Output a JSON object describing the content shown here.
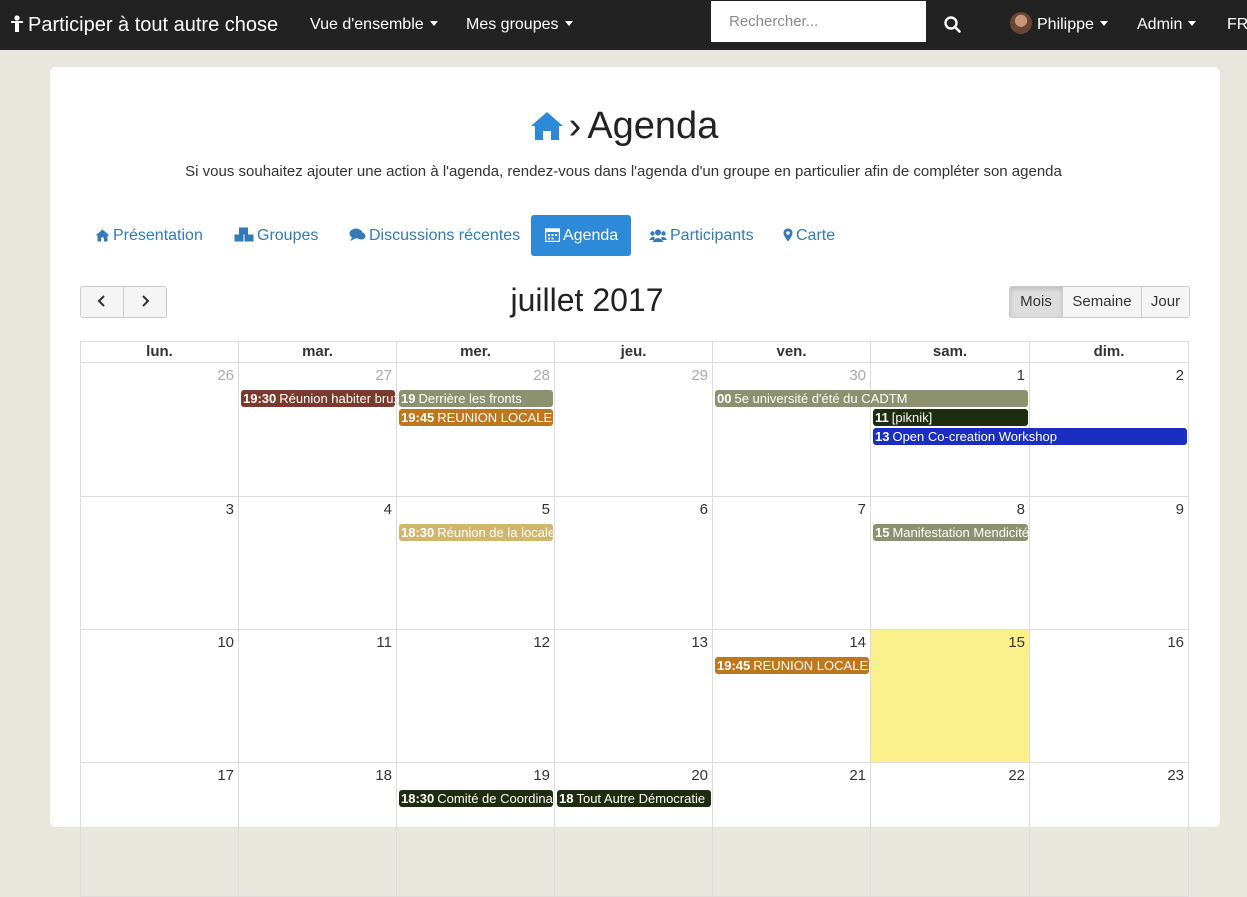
{
  "navbar": {
    "brand": "Participer à tout autre chose",
    "menu_overview": "Vue d'ensemble",
    "menu_groups": "Mes groupes",
    "search_placeholder": "Rechercher...",
    "user": "Philippe",
    "admin": "Admin",
    "lang": "FR"
  },
  "page": {
    "title": "Agenda",
    "subtitle": "Si vous souhaitez ajouter une action à l'agenda, rendez-vous dans l'agenda d'un groupe en particulier afin de compléter son agenda"
  },
  "tabs": [
    {
      "label": "Présentation",
      "icon": "home-icon",
      "active": false
    },
    {
      "label": "Groupes",
      "icon": "cubes-icon",
      "active": false
    },
    {
      "label": "Discussions récentes",
      "icon": "comments-icon",
      "active": false
    },
    {
      "label": "Agenda",
      "icon": "calendar-icon",
      "active": true
    },
    {
      "label": "Participants",
      "icon": "users-icon",
      "active": false
    },
    {
      "label": "Carte",
      "icon": "map-marker-icon",
      "active": false
    }
  ],
  "calendar": {
    "title": "juillet 2017",
    "views": [
      "Mois",
      "Semaine",
      "Jour"
    ],
    "active_view": "Mois",
    "weekdays": [
      "lun.",
      "mar.",
      "mer.",
      "jeu.",
      "ven.",
      "sam.",
      "dim."
    ],
    "weeks": [
      [
        {
          "d": "26",
          "other": true
        },
        {
          "d": "27",
          "other": true
        },
        {
          "d": "28",
          "other": true
        },
        {
          "d": "29",
          "other": true
        },
        {
          "d": "30",
          "other": true
        },
        {
          "d": "1"
        },
        {
          "d": "2"
        }
      ],
      [
        {
          "d": "3"
        },
        {
          "d": "4"
        },
        {
          "d": "5"
        },
        {
          "d": "6"
        },
        {
          "d": "7"
        },
        {
          "d": "8"
        },
        {
          "d": "9"
        }
      ],
      [
        {
          "d": "10"
        },
        {
          "d": "11"
        },
        {
          "d": "12"
        },
        {
          "d": "13"
        },
        {
          "d": "14"
        },
        {
          "d": "15",
          "today": true
        },
        {
          "d": "16"
        }
      ],
      [
        {
          "d": "17"
        },
        {
          "d": "18"
        },
        {
          "d": "19"
        },
        {
          "d": "20"
        },
        {
          "d": "21"
        },
        {
          "d": "22"
        },
        {
          "d": "23"
        }
      ]
    ],
    "events": [
      {
        "week": 0,
        "col": 1,
        "span": 1,
        "slot": 0,
        "time": "19:30",
        "title": "Réunion habiter bruxelles",
        "color": "#7a3b2e"
      },
      {
        "week": 0,
        "col": 2,
        "span": 1,
        "slot": 0,
        "time": "19",
        "title": "Derrière les fronts",
        "color": "#8c9270"
      },
      {
        "week": 0,
        "col": 2,
        "span": 1,
        "slot": 1,
        "time": "19:45",
        "title": "REUNION LOCALE",
        "color": "#c0761c"
      },
      {
        "week": 0,
        "col": 4,
        "span": 2,
        "slot": 0,
        "time": "00",
        "title": "5e université d'été du CADTM",
        "color": "#8c9270"
      },
      {
        "week": 0,
        "col": 5,
        "span": 1,
        "slot": 1,
        "time": "11",
        "title": "[piknik]",
        "color": "#1e2d0f"
      },
      {
        "week": 0,
        "col": 5,
        "span": 2,
        "slot": 2,
        "time": "13",
        "title": "Open Co-creation Workshop",
        "color": "#1a2fc2"
      },
      {
        "week": 1,
        "col": 2,
        "span": 1,
        "slot": 0,
        "time": "18:30",
        "title": "Réunion de la locale",
        "color": "#d3b66e"
      },
      {
        "week": 1,
        "col": 5,
        "span": 1,
        "slot": 0,
        "time": "15",
        "title": "Manifestation Mendicité",
        "color": "#8c9270"
      },
      {
        "week": 2,
        "col": 4,
        "span": 1,
        "slot": 0,
        "time": "19:45",
        "title": "REUNION LOCALE",
        "color": "#c0761c"
      },
      {
        "week": 3,
        "col": 2,
        "span": 1,
        "slot": 0,
        "time": "18:30",
        "title": "Comité de Coordination",
        "color": "#1e2d0f"
      },
      {
        "week": 3,
        "col": 3,
        "span": 1,
        "slot": 0,
        "time": "18",
        "title": "Tout Autre Démocratie",
        "color": "#1e2d0f"
      }
    ]
  }
}
